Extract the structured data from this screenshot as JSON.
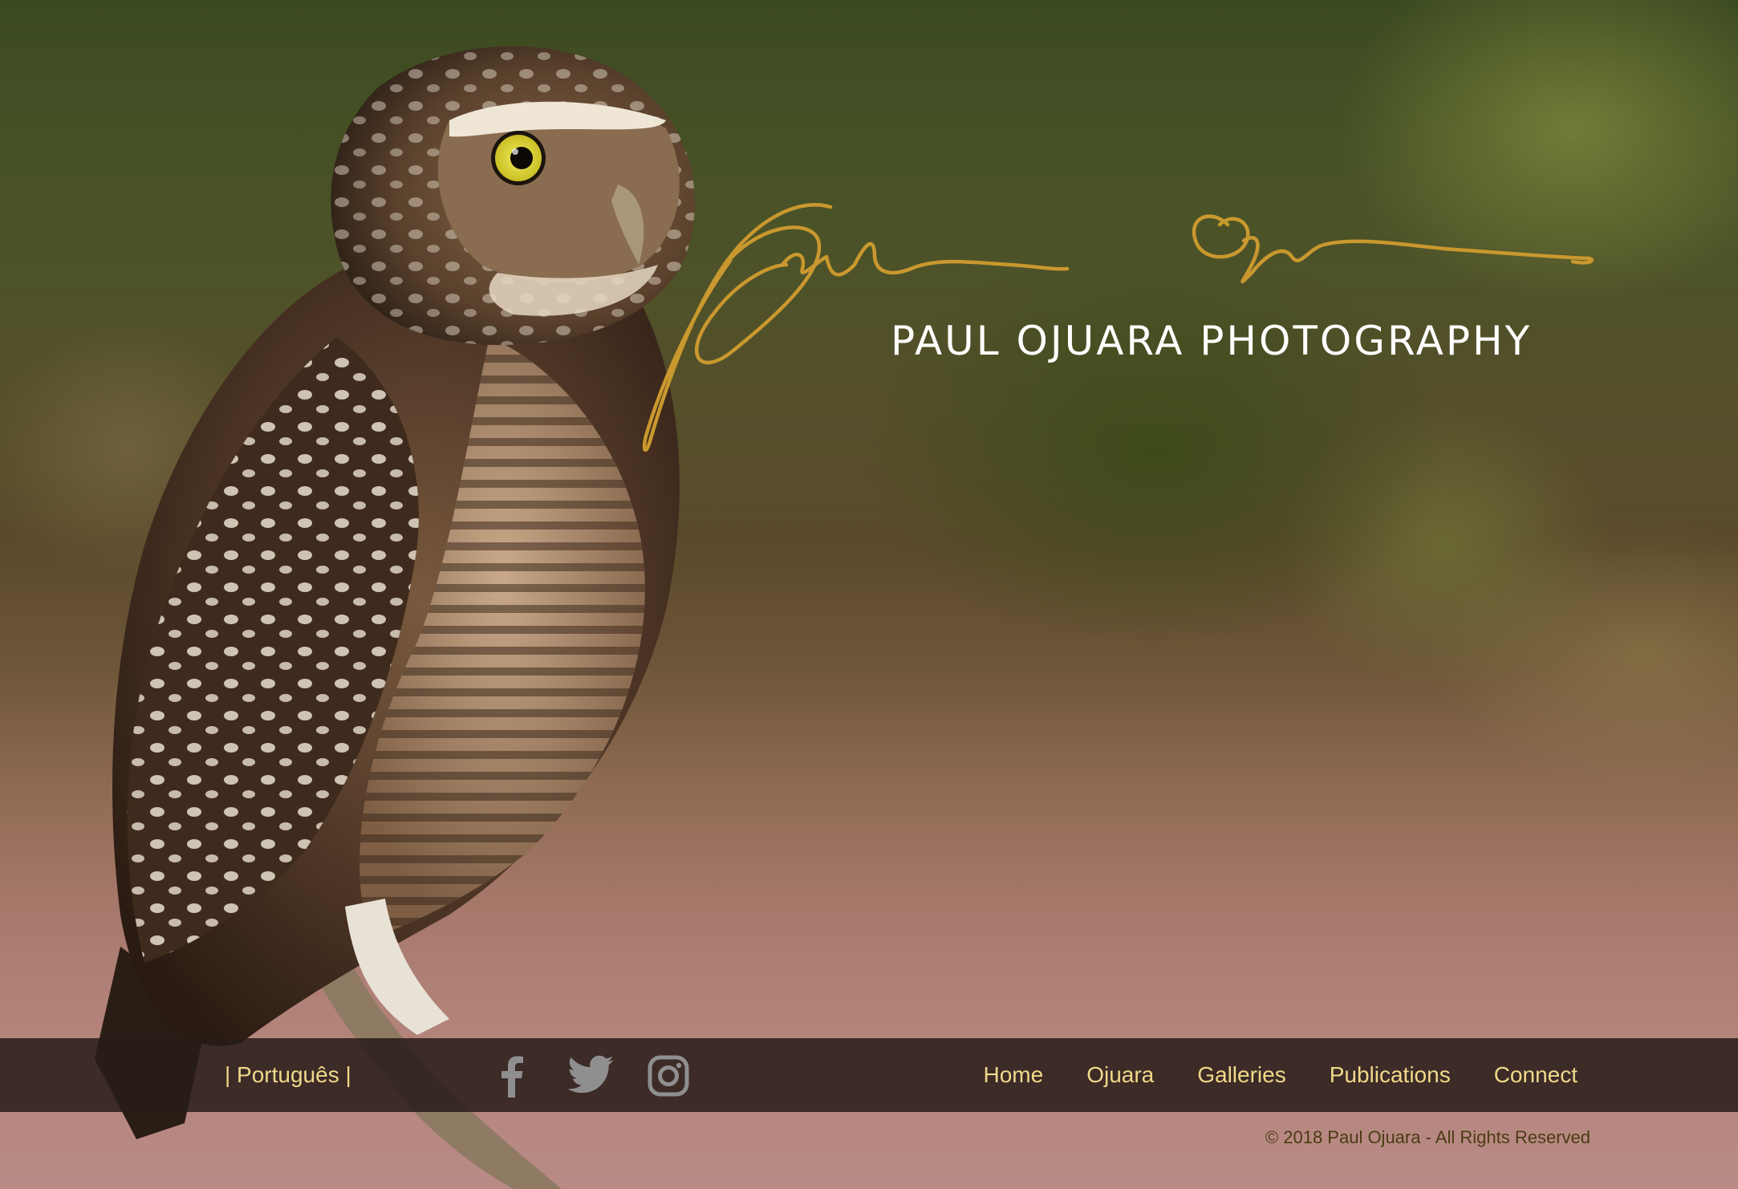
{
  "brand": {
    "title": "PAUL OJUARA PHOTOGRAPHY",
    "signature_icon": "signature-logo",
    "signature_color": "#c9982e"
  },
  "nav": {
    "language": "| Português |",
    "social": [
      {
        "name": "facebook-icon"
      },
      {
        "name": "twitter-icon"
      },
      {
        "name": "instagram-icon"
      }
    ],
    "menu": [
      "Home",
      "Ojuara",
      "Galleries",
      "Publications",
      "Connect"
    ],
    "text_color": "#f0d98a",
    "bar_color": "#2a1c18"
  },
  "footer": {
    "copyright": "© 2018 Paul Ojuara - All Rights Reserved"
  }
}
